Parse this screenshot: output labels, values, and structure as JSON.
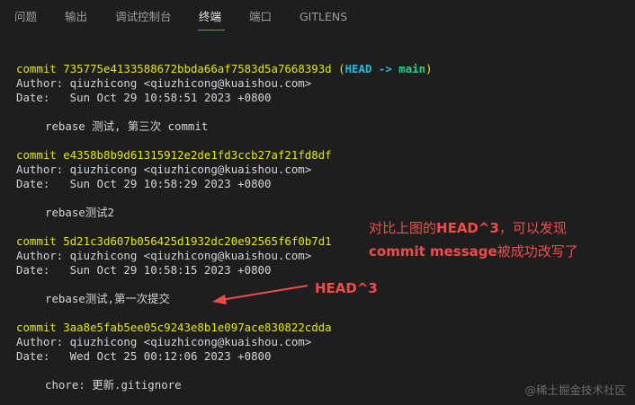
{
  "tabs": [
    {
      "label": "问题",
      "active": false
    },
    {
      "label": "输出",
      "active": false
    },
    {
      "label": "调试控制台",
      "active": false
    },
    {
      "label": "终端",
      "active": true
    },
    {
      "label": "端口",
      "active": false
    },
    {
      "label": "GITLENS",
      "active": false
    }
  ],
  "commits": [
    {
      "prefix": "commit",
      "hash": "735775e4133588672bbda66af7583d5a7668393d",
      "ref_open": "(",
      "ref_head": "HEAD -> ",
      "ref_branch": "main",
      "ref_close": ")",
      "author": "Author: qiuzhicong <qiuzhicong@kuaishou.com>",
      "date": "Date:   Sun Oct 29 10:58:51 2023 +0800",
      "message": "rebase 测试, 第三次 commit"
    },
    {
      "prefix": "commit",
      "hash": "e4358b8b9d61315912e2de1fd3ccb27af21fd8df",
      "author": "Author: qiuzhicong <qiuzhicong@kuaishou.com>",
      "date": "Date:   Sun Oct 29 10:58:29 2023 +0800",
      "message": "rebase测试2"
    },
    {
      "prefix": "commit",
      "hash": "5d21c3d607b056425d1932dc20e92565f6f0b7d1",
      "author": "Author: qiuzhicong <qiuzhicong@kuaishou.com>",
      "date": "Date:   Sun Oct 29 10:58:15 2023 +0800",
      "message": "rebase测试,第一次提交"
    },
    {
      "prefix": "commit",
      "hash": "3aa8e5fab5ee05c9243e8b1e097ace830822cdda",
      "author": "Author: qiuzhicong <qiuzhicong@kuaishou.com>",
      "date": "Date:   Wed Oct 25 00:12:06 2023 +0800",
      "message": "chore: 更新.gitignore"
    }
  ],
  "annotations": {
    "note_line1_prefix": "对比上图的",
    "note_line1_head": "HEAD^3",
    "note_line1_suffix": "，可以发现",
    "note_line2_bold": "commit message",
    "note_line2_suffix": "被成功改写了",
    "arrow_label": "HEAD^3",
    "color": "#f14c4c"
  },
  "watermark": "@稀土掘金技术社区",
  "colors": {
    "background": "#1e1e1e",
    "hash": "#e5e510",
    "head": "#29b8db",
    "branch": "#23d18b",
    "tab_active_underline": "#3794ff"
  }
}
